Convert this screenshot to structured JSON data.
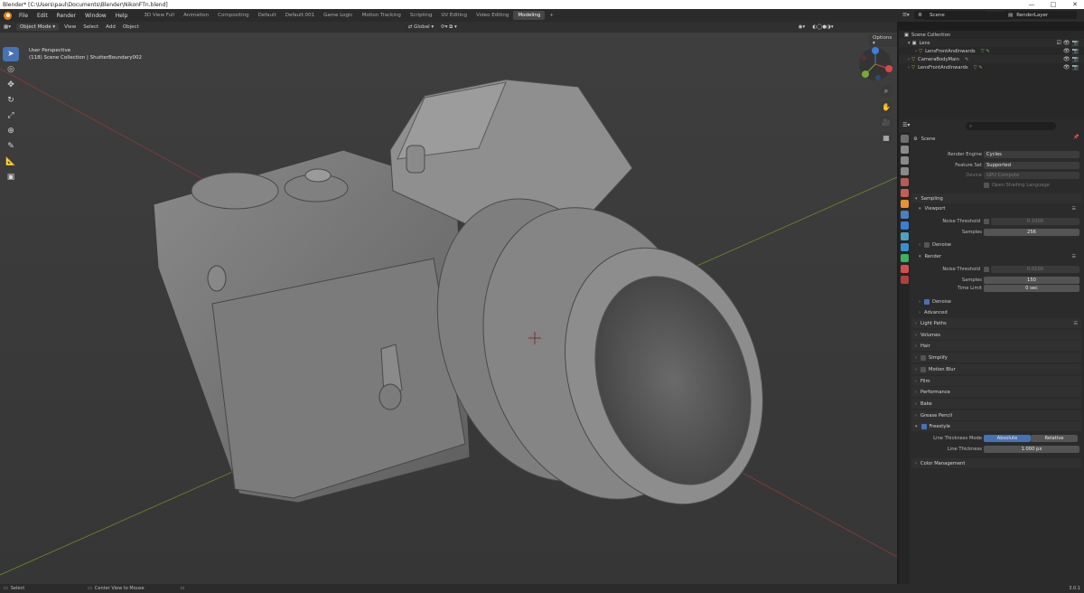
{
  "titlebar": {
    "title": "Blender* [C:\\Users\\paul\\Documents\\Blender\\NikonFTn.blend]",
    "controls": [
      "—",
      "□",
      "✕"
    ]
  },
  "menu": [
    "File",
    "Edit",
    "Render",
    "Window",
    "Help"
  ],
  "workspaces": [
    "3D View Full",
    "Animation",
    "Compositing",
    "Default",
    "Default.001",
    "Game Logic",
    "Motion Tracking",
    "Scripting",
    "UV Editing",
    "Video Editing",
    "Modeling",
    "+"
  ],
  "active_workspace": "Modeling",
  "topright": {
    "scene": "Scene",
    "layer": "RenderLayer"
  },
  "viewport_header": {
    "mode": "Object Mode",
    "menus": [
      "View",
      "Select",
      "Add",
      "Object"
    ],
    "orientation": "Global",
    "options": "Options"
  },
  "viewport": {
    "perspective": "User Perspective",
    "collection_info": "(118) Scene Collection | ShutterBoundary002"
  },
  "outliner": {
    "search_placeholder": "",
    "rows": [
      {
        "label": "Scene Collection",
        "indent": 0
      },
      {
        "label": "Lens",
        "indent": 1
      },
      {
        "label": "LensFrontAndInwards",
        "indent": 2
      },
      {
        "label": "CameraBodyMain",
        "indent": 1
      },
      {
        "label": "LensFrontAndInwards",
        "indent": 1
      }
    ]
  },
  "properties": {
    "scene_label": "Scene",
    "render_engine": {
      "label": "Render Engine",
      "value": "Cycles"
    },
    "feature_set": {
      "label": "Feature Set",
      "value": "Supported"
    },
    "device": {
      "label": "Device",
      "value": "GPU Compute"
    },
    "osl": "Open Shading Language",
    "sampling": "Sampling",
    "viewport_section": "Viewport",
    "vp_noise_threshold": {
      "label": "Noise Threshold",
      "value": "0.1000"
    },
    "vp_samples": {
      "label": "Samples",
      "value": "256"
    },
    "vp_denoise": "Denoise",
    "render_section": "Render",
    "r_noise_threshold": {
      "label": "Noise Threshold",
      "value": "0.0100"
    },
    "r_samples": {
      "label": "Samples",
      "value": "150"
    },
    "r_time_limit": {
      "label": "Time Limit",
      "value": "0 sec"
    },
    "r_denoise": "Denoise",
    "advanced": "Advanced",
    "sections": [
      "Light Paths",
      "Volumes",
      "Hair",
      "Simplify",
      "Motion Blur",
      "Film",
      "Performance",
      "Bake",
      "Grease Pencil"
    ],
    "freestyle": "Freestyle",
    "line_thickness_mode": {
      "label": "Line Thickness Mode",
      "options": [
        "Absolute",
        "Relative"
      ],
      "selected": "Absolute"
    },
    "line_thickness": {
      "label": "Line Thickness",
      "value": "1.000 px"
    },
    "color_management": "Color Management"
  },
  "statusbar": {
    "select": "Select",
    "center": "Center View to Mouse",
    "version": "3.0.1"
  },
  "colors": {
    "accent": "#4772b3",
    "orange": "#e87d0d",
    "viewport_bg": "#3c3c3c"
  }
}
